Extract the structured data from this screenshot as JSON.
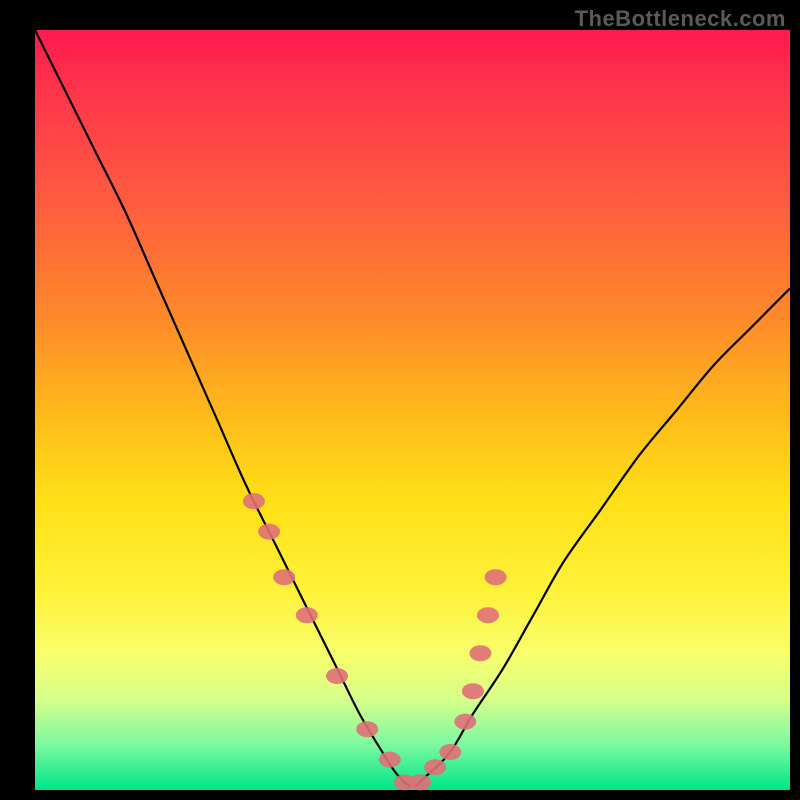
{
  "watermark": "TheBottleneck.com",
  "colors": {
    "frame": "#000000",
    "curve_stroke": "#000000",
    "marker_fill": "#e07078",
    "gradient_stops": [
      "#ff1a50",
      "#ff3a4a",
      "#ff5a40",
      "#ff8a2a",
      "#ffb81c",
      "#ffe016",
      "#fff23a",
      "#f8ff6a",
      "#d8ff8a",
      "#7cf9a0",
      "#00e589"
    ]
  },
  "chart_data": {
    "type": "line",
    "title": "",
    "xlabel": "",
    "ylabel": "",
    "xlim": [
      0,
      100
    ],
    "ylim": [
      0,
      100
    ],
    "series": [
      {
        "name": "bottleneck-curve",
        "x": [
          0,
          4,
          8,
          12,
          16,
          20,
          24,
          28,
          32,
          36,
          40,
          43,
          46,
          48,
          50,
          52,
          55,
          58,
          62,
          66,
          70,
          75,
          80,
          85,
          90,
          95,
          100
        ],
        "y": [
          100,
          92,
          84,
          76,
          67,
          58,
          49,
          40,
          32,
          24,
          16,
          10,
          5,
          2,
          0.5,
          2,
          5,
          10,
          16,
          23,
          30,
          37,
          44,
          50,
          56,
          61,
          66
        ]
      }
    ],
    "markers": {
      "name": "highlighted-points",
      "x": [
        29,
        31,
        33,
        36,
        40,
        44,
        47,
        49,
        51,
        53,
        55,
        57,
        58,
        59,
        60,
        61
      ],
      "y": [
        38,
        34,
        28,
        23,
        15,
        8,
        4,
        1,
        1,
        3,
        5,
        9,
        13,
        18,
        23,
        28
      ]
    }
  }
}
